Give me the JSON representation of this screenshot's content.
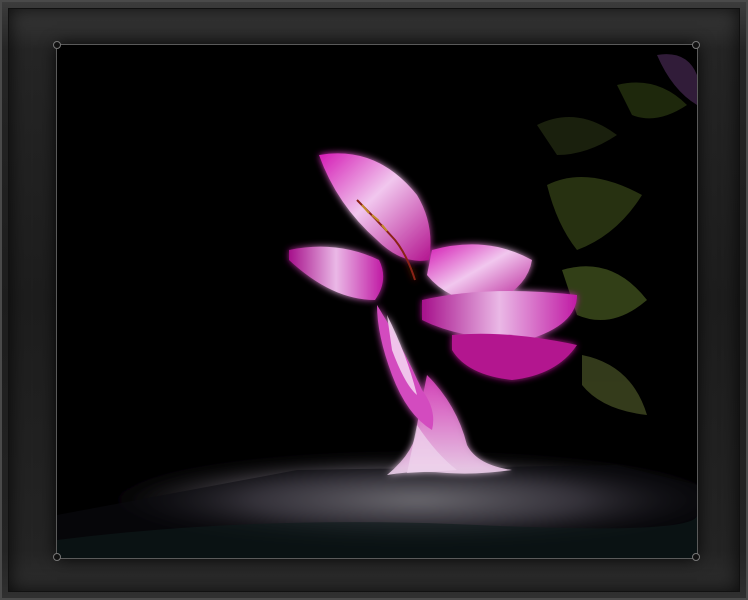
{
  "image": {
    "alt": "",
    "colors": {
      "frame": "#262626",
      "background": "#000000",
      "petal": "#c3169e",
      "petal_highlight": "#f2d2f0",
      "leaf": "#3b4a1c",
      "floor_light": "#e8e4ee"
    }
  }
}
